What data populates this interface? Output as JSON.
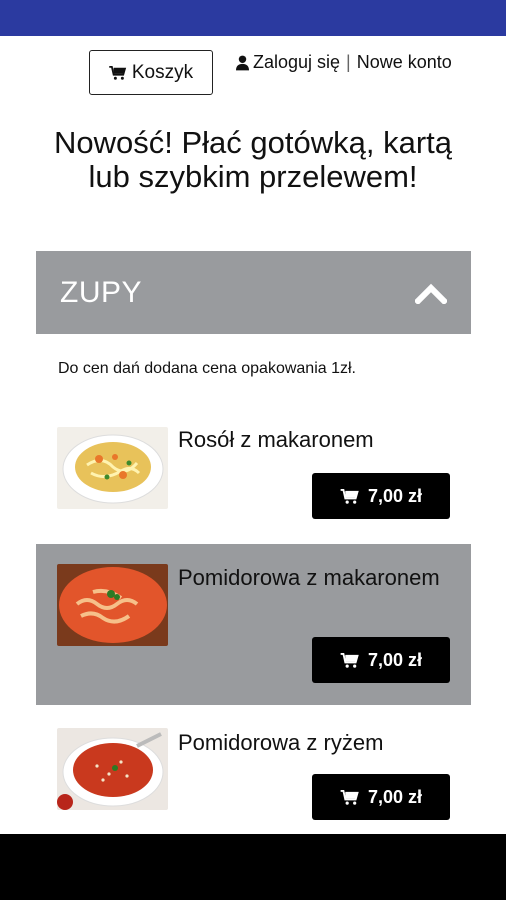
{
  "header": {
    "cart_label": "Koszyk",
    "login_label": "Zaloguj się",
    "separator": "|",
    "register_label": "Nowe konto"
  },
  "promo": {
    "text": "Nowość! Płać gotówką, kartą lub szybkim przelewem!"
  },
  "category": {
    "title": "ZUPY",
    "notice": "Do cen dań dodana cena opakowania 1zł."
  },
  "items": [
    {
      "name": "Rosół z makaronem",
      "price": "7,00 zł"
    },
    {
      "name": "Pomidorowa z makaronem",
      "price": "7,00 zł"
    },
    {
      "name": "Pomidorowa z ryżem",
      "price": "7,00 zł"
    }
  ],
  "colors": {
    "status_bar": "#2b3aa0",
    "category_bg": "#999b9e",
    "price_button": "#000000"
  }
}
